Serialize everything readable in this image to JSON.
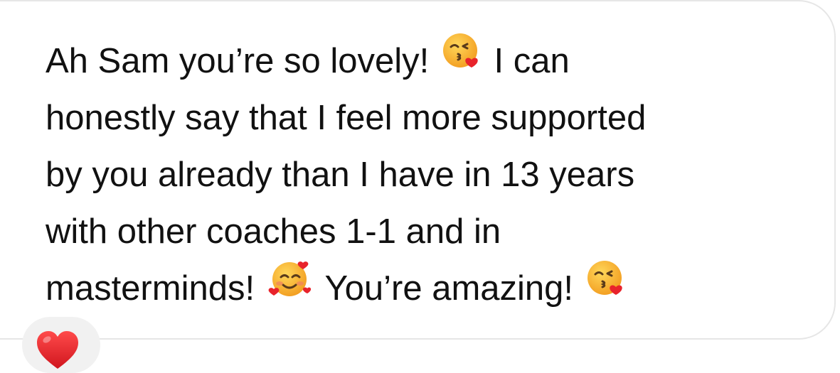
{
  "message": {
    "line1_a": "Ah Sam you’re so lovely!",
    "line1_emoji": "face-blowing-kiss-emoji",
    "line1_b": "I can",
    "line2": "honestly say that I feel more supported",
    "line3": "by you already than I have in 13 years",
    "line4": "with other coaches 1-1 and in",
    "line5_a": "masterminds!",
    "line5_emoji": "smiling-face-with-hearts-emoji",
    "line5_b": "You’re amazing!",
    "line5_emoji_end": "face-blowing-kiss-emoji"
  },
  "reaction": {
    "icon": "red-heart-icon"
  },
  "colors": {
    "text": "#111111",
    "bubble_border": "#e6e6e6",
    "reaction_bg": "#f1f1f1",
    "heart": "#e8232b",
    "emoji_face": "#f7b32b"
  }
}
